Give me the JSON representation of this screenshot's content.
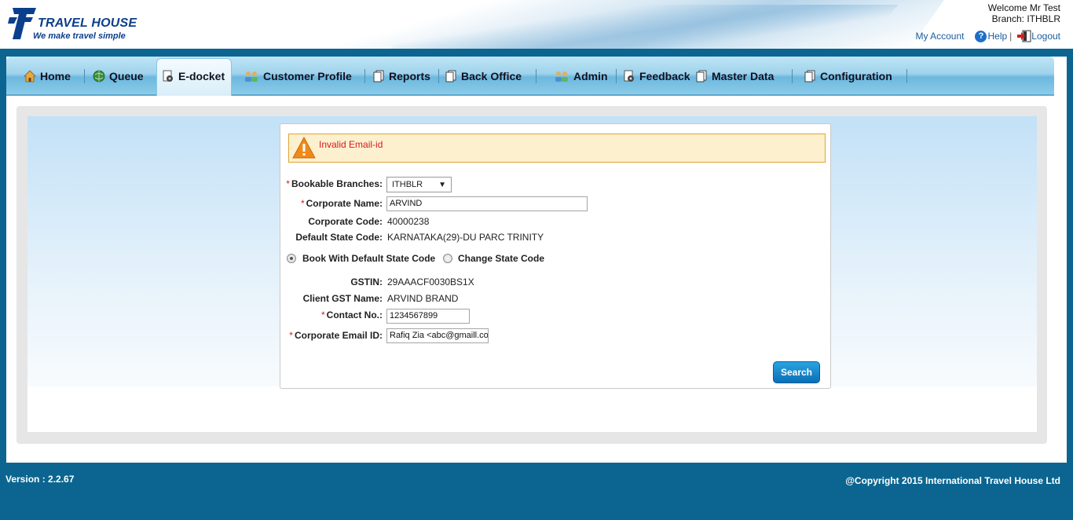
{
  "brand": {
    "name": "TRAVEL HOUSE",
    "tagline": "We make travel simple"
  },
  "user": {
    "welcome": "Welcome Mr Test",
    "branch": "Branch: ITHBLR"
  },
  "toplinks": {
    "my_account": "My Account",
    "help": "Help",
    "separator": "|",
    "logout": "Logout"
  },
  "nav": {
    "active": "E-docket",
    "items": [
      {
        "label": "Home",
        "icon": "home-icon"
      },
      {
        "label": "Queue",
        "icon": "globe-icon"
      },
      {
        "label": "E-docket",
        "icon": "docket-icon"
      },
      {
        "label": "Customer Profile",
        "icon": "users-icon"
      },
      {
        "label": "Reports",
        "icon": "pages-icon"
      },
      {
        "label": "Back Office",
        "icon": "pages-icon"
      },
      {
        "label": "Admin",
        "icon": "users-icon"
      },
      {
        "label": "Feedback",
        "icon": "docket-icon"
      },
      {
        "label": "Master Data",
        "icon": "pages-icon"
      },
      {
        "label": "Configuration",
        "icon": "pages-icon"
      }
    ]
  },
  "alert": {
    "message": "Invalid Email-id",
    "icon": "warning-icon"
  },
  "form": {
    "bookable_branches": {
      "label": "Bookable Branches:",
      "value": "ITHBLR"
    },
    "corporate_name": {
      "label": "Corporate Name:",
      "value": "ARVIND"
    },
    "corporate_code": {
      "label": "Corporate Code:",
      "value": "40000238"
    },
    "default_state_code": {
      "label": "Default State Code:",
      "value": "KARNATAKA(29)-DU PARC TRINITY"
    },
    "state_code_options": {
      "default": "Book With Default State Code",
      "change": "Change State Code",
      "selected": "default"
    },
    "gstin": {
      "label": "GSTIN:",
      "value": "29AAACF0030BS1X"
    },
    "client_gst_name": {
      "label": "Client GST Name:",
      "value": "ARVIND BRAND"
    },
    "contact_no": {
      "label": "Contact No.:",
      "value": "1234567899"
    },
    "corporate_email": {
      "label": "Corporate Email ID:",
      "value": "Rafiq Zia <abc@gmaill.co"
    },
    "required_marker": "*",
    "search_button": "Search"
  },
  "footer": {
    "version": "Version : 2.2.67",
    "copyright": "@Copyright 2015 International Travel House Ltd"
  },
  "colors": {
    "page_background": "#0b6590",
    "nav_gradient_top": "#bfe4f5",
    "alert_background": "#fdf0cf",
    "alert_text": "#d21d1d",
    "button": "#0b6fb6"
  }
}
